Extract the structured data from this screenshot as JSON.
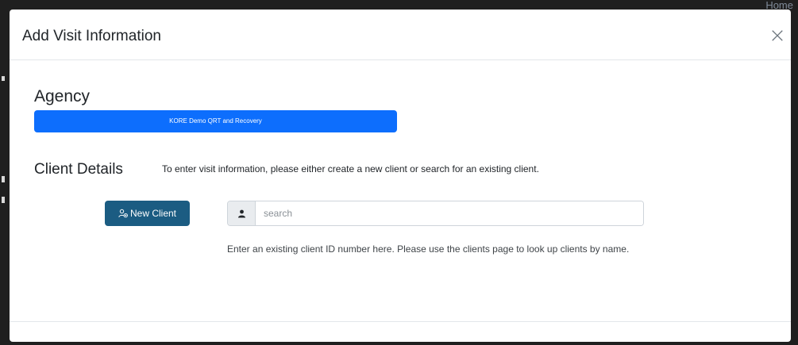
{
  "background": {
    "top_link": "Home"
  },
  "modal": {
    "title": "Add Visit Information",
    "close_glyph": "×",
    "agency": {
      "heading": "Agency",
      "name": "KORE Demo QRT and Recovery",
      "bar_color": "#0d6efd"
    },
    "client_details": {
      "heading": "Client Details",
      "instructions": "To enter visit information, please either create a new client or search for an existing client.",
      "new_client_button": {
        "label": "New Client",
        "icon": "user-plus-icon",
        "color": "#1b5c82"
      },
      "search": {
        "icon": "person-icon",
        "placeholder": "search",
        "value": ""
      },
      "help_text": "Enter an existing client ID number here. Please use the clients page to look up clients by name."
    }
  }
}
